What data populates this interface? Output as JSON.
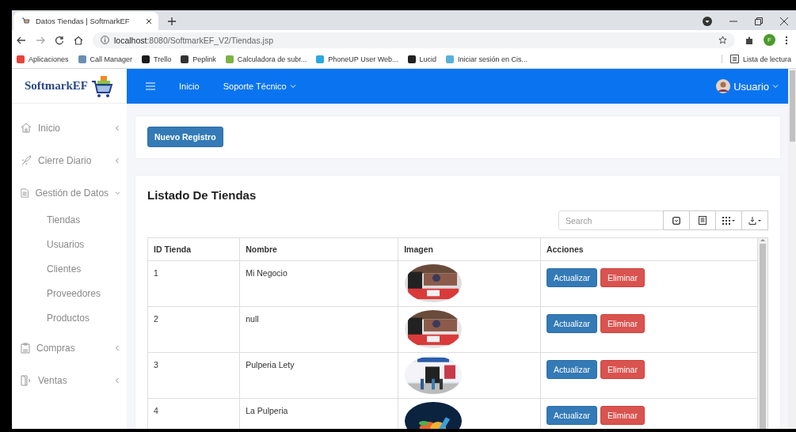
{
  "browser": {
    "tab_title": "Datos Tiendas | SoftmarkEF",
    "url_host": "localhost",
    "url_path": ":8080/SoftmarkEF_V2/Tiendas.jsp",
    "profile_initial": "F",
    "bookmarks": [
      "Aplicaciones",
      "Call Manager",
      "Trello",
      "Peplink",
      "Calculadora de subr...",
      "PhoneUP User Web...",
      "Lucid",
      "Iniciar sesión en Cis..."
    ],
    "reading_list": "Lista de lectura"
  },
  "header": {
    "nav": [
      {
        "label": "Inicio",
        "dropdown": false
      },
      {
        "label": "Soporte Técnico",
        "dropdown": true
      }
    ],
    "user": "Usuario"
  },
  "sidebar": {
    "logo": "SoftmarkEF",
    "items": [
      {
        "label": "Inicio",
        "expanded": false
      },
      {
        "label": "Cierre Diario",
        "expanded": false
      },
      {
        "label": "Gestión de Datos",
        "expanded": true,
        "children": [
          "Tiendas",
          "Usuarios",
          "Clientes",
          "Proveedores",
          "Productos"
        ]
      },
      {
        "label": "Compras",
        "expanded": false
      },
      {
        "label": "Ventas",
        "expanded": false
      }
    ]
  },
  "new_button": "Nuevo Registro",
  "list": {
    "title": "Listado De Tiendas",
    "search": {
      "placeholder": "Search"
    },
    "columns": [
      "ID Tienda",
      "Nombre",
      "Imagen",
      "Acciones"
    ],
    "rows": [
      {
        "id": "1",
        "name": "Mi Negocio",
        "actions": [
          "Actualizar",
          "Eliminar"
        ]
      },
      {
        "id": "2",
        "name": "null",
        "actions": [
          "Actualizar",
          "Eliminar"
        ]
      },
      {
        "id": "3",
        "name": "Pulperia Lety",
        "actions": [
          "Actualizar",
          "Eliminar"
        ]
      },
      {
        "id": "4",
        "name": "La Pulperia",
        "actions": [
          "Actualizar",
          "Eliminar"
        ]
      }
    ]
  }
}
